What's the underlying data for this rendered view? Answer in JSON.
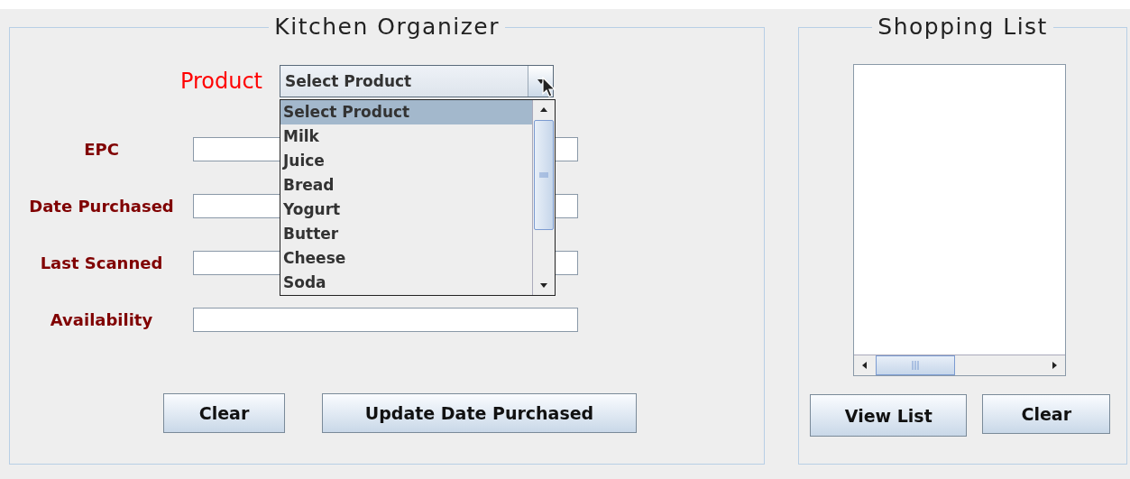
{
  "kitchen_organizer": {
    "title": "Kitchen Organizer",
    "product": {
      "label": "Product",
      "value": "Select Product",
      "expanded": true,
      "options": [
        {
          "label": "Select Product",
          "selected": true
        },
        {
          "label": "Milk",
          "selected": false
        },
        {
          "label": "Juice",
          "selected": false
        },
        {
          "label": "Bread",
          "selected": false
        },
        {
          "label": "Yogurt",
          "selected": false
        },
        {
          "label": "Butter",
          "selected": false
        },
        {
          "label": "Cheese",
          "selected": false
        },
        {
          "label": "Soda",
          "selected": false
        }
      ]
    },
    "fields": [
      {
        "label": "EPC"
      },
      {
        "label": "Date Purchased"
      },
      {
        "label": "Last Scanned"
      },
      {
        "label": "Availability"
      }
    ],
    "buttons": [
      "Clear",
      "Update Date Purchased"
    ]
  },
  "shopping_list": {
    "title": "Shopping List",
    "buttons": [
      "View List",
      "Clear"
    ]
  }
}
